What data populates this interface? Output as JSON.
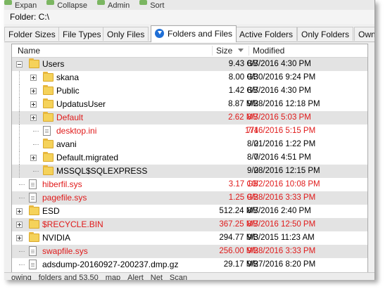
{
  "toolbar_items": [
    "Expan",
    "Collapse",
    "Admin",
    "Sort"
  ],
  "folder_label": "Folder: C:\\",
  "tabs": [
    {
      "label": "Folder Sizes"
    },
    {
      "label": "File Types"
    },
    {
      "label": "Only Files"
    },
    {
      "label": "Folders and Files",
      "active": true
    },
    {
      "label": "Active Folders"
    },
    {
      "label": "Only Folders"
    },
    {
      "label": "Own"
    }
  ],
  "columns": {
    "name": "Name",
    "size": "Size",
    "modified": "Modified"
  },
  "rows": [
    {
      "name": "Users",
      "size": "9.43 GB",
      "modified": "8/7/2016 4:30 PM",
      "type": "folder",
      "level": 0,
      "expander": "minus",
      "red": false,
      "sel": true
    },
    {
      "name": "skana",
      "size": "8.00 GB",
      "modified": "9/30/2016 9:24 PM",
      "type": "folder",
      "level": 1,
      "expander": "plus",
      "red": false,
      "sel": false
    },
    {
      "name": "Public",
      "size": "1.42 GB",
      "modified": "8/7/2016 4:30 PM",
      "type": "folder",
      "level": 1,
      "expander": "plus",
      "red": false,
      "sel": false
    },
    {
      "name": "UpdatusUser",
      "size": "8.87 MB",
      "modified": "9/28/2016 12:18 PM",
      "type": "folder",
      "level": 1,
      "expander": "plus",
      "red": false,
      "sel": false
    },
    {
      "name": "Default",
      "size": "2.62 MB",
      "modified": "8/7/2016 5:03 PM",
      "type": "folder",
      "level": 1,
      "expander": "plus",
      "red": true,
      "sel": true
    },
    {
      "name": "desktop.ini",
      "size": "174",
      "modified": "7/16/2016 5:15 PM",
      "type": "file",
      "level": 1,
      "expander": "none",
      "red": true,
      "sel": false
    },
    {
      "name": "avani",
      "size": "0",
      "modified": "8/21/2016 1:22 PM",
      "type": "folder",
      "level": 1,
      "expander": "none",
      "red": false,
      "sel": false
    },
    {
      "name": "Default.migrated",
      "size": "0",
      "modified": "8/7/2016 4:51 PM",
      "type": "folder",
      "level": 1,
      "expander": "plus",
      "red": false,
      "sel": false
    },
    {
      "name": "MSSQL$SQLEXPRESS",
      "size": "0",
      "modified": "9/28/2016 12:15 PM",
      "type": "folder",
      "level": 1,
      "expander": "none",
      "red": false,
      "sel": true
    },
    {
      "name": "hiberfil.sys",
      "size": "3.17 GB",
      "modified": "10/2/2016 10:08 PM",
      "type": "file",
      "level": 0,
      "expander": "none",
      "red": true,
      "sel": false
    },
    {
      "name": "pagefile.sys",
      "size": "1.25 GB",
      "modified": "9/28/2016 3:33 PM",
      "type": "file",
      "level": 0,
      "expander": "none",
      "red": true,
      "sel": true
    },
    {
      "name": "ESD",
      "size": "512.24 MB",
      "modified": "8/7/2016 2:40 PM",
      "type": "folder",
      "level": 0,
      "expander": "plus",
      "red": false,
      "sel": false
    },
    {
      "name": "$RECYCLE.BIN",
      "size": "367.25 MB",
      "modified": "8/7/2016 12:50 PM",
      "type": "folder",
      "level": 0,
      "expander": "plus",
      "red": true,
      "sel": true
    },
    {
      "name": "NVIDIA",
      "size": "294.77 MB",
      "modified": "9/3/2015 11:23 AM",
      "type": "folder",
      "level": 0,
      "expander": "plus",
      "red": false,
      "sel": false
    },
    {
      "name": "swapfile.sys",
      "size": "256.00 MB",
      "modified": "9/28/2016 3:33 PM",
      "type": "file",
      "level": 0,
      "expander": "none",
      "red": true,
      "sel": true
    },
    {
      "name": "adsdump-20160927-200237.dmp.gz",
      "size": "29.17 MB",
      "modified": "9/27/2016 8:20 PM",
      "type": "file",
      "level": 0,
      "expander": "none",
      "red": false,
      "sel": false
    }
  ],
  "status_items": [
    "owing",
    "folders and 53,50",
    "map",
    "Alert",
    "Net",
    "Scan"
  ],
  "colors": {
    "red": "#e01a1a",
    "selected_row": "#e3e3e3",
    "folder": "#f5d25a",
    "tab_icon": "#1f6fd6"
  }
}
